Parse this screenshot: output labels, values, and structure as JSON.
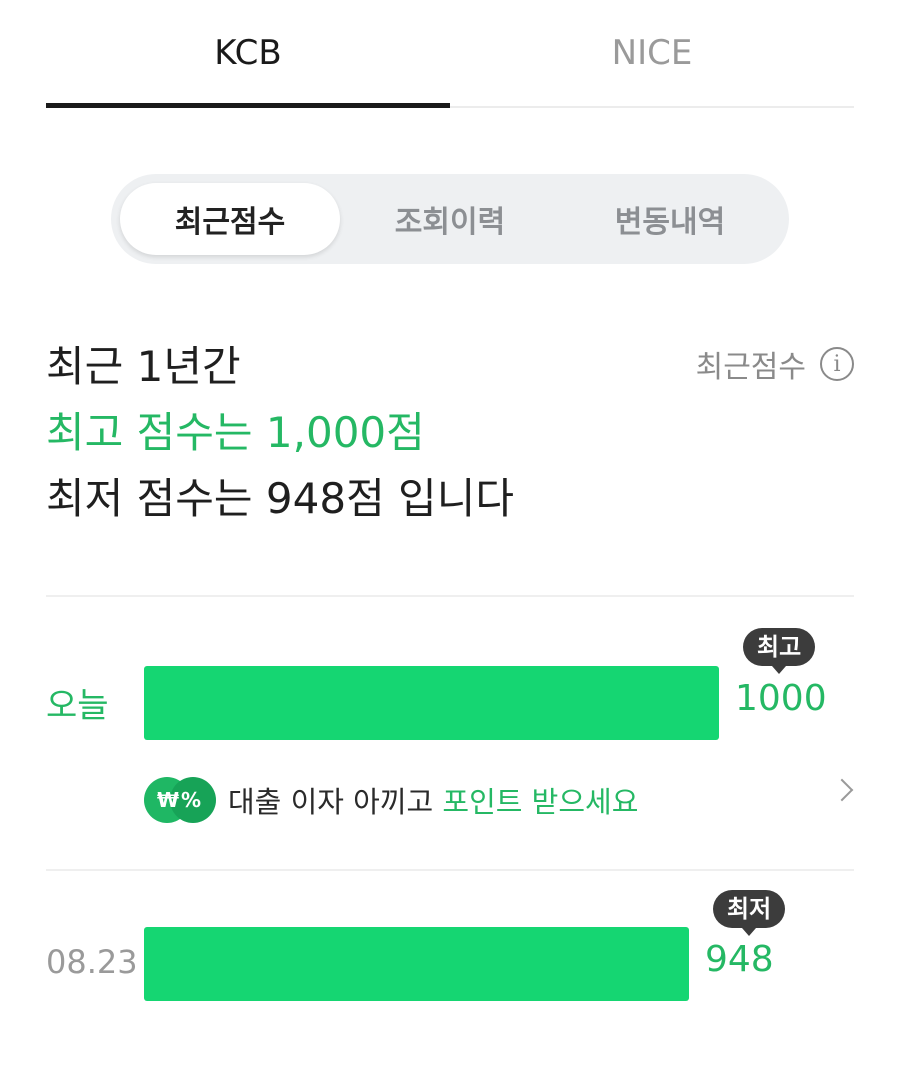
{
  "top_tabs": [
    {
      "label": "KCB",
      "active": true
    },
    {
      "label": "NICE",
      "active": false
    }
  ],
  "segments": [
    {
      "label": "최근점수",
      "active": true
    },
    {
      "label": "조회이력",
      "active": false
    },
    {
      "label": "변동내역",
      "active": false
    }
  ],
  "summary": {
    "line1": "최근 1년간",
    "line2": "최고 점수는 1,000점",
    "line3": "최저 점수는 948점 입니다"
  },
  "recent_info_label": "최근점수",
  "info_icon": "info-circle-icon",
  "rows": [
    {
      "label": "오늘",
      "value": "1000",
      "badge": "최고",
      "score": 1000
    },
    {
      "label": "08.23",
      "value": "948",
      "badge": "최저",
      "score": 948
    }
  ],
  "promo": {
    "icon": "won-percent-coins-icon",
    "icon_symbols": "₩%",
    "text_prefix": "대출 이자 아끼고 ",
    "text_highlight": "포인트 받으세요"
  },
  "colors": {
    "accent_green": "#25b864",
    "bar_green": "#15d672",
    "badge_bg": "#3c3c3c"
  }
}
